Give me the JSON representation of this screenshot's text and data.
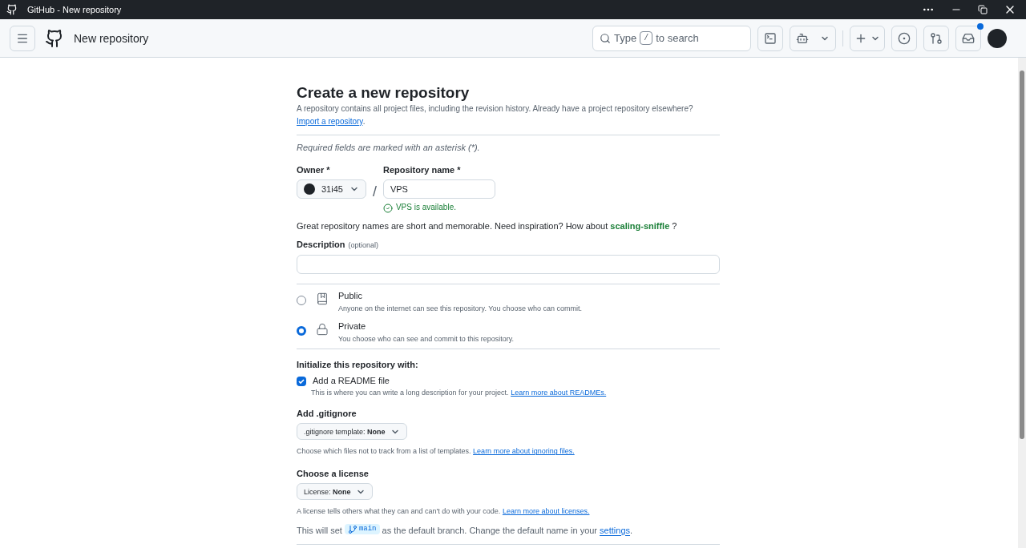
{
  "window": {
    "title": "GitHub - New repository"
  },
  "header": {
    "title": "New repository",
    "search": {
      "before": "Type",
      "key": "/",
      "after": "to search"
    },
    "has_notification": true
  },
  "page": {
    "heading": "Create a new repository",
    "intro": "A repository contains all project files, including the revision history. Already have a project repository elsewhere?",
    "intro_link": "Import a repository",
    "intro_end": ".",
    "required_note": "Required fields are marked with an asterisk (*).",
    "owner": {
      "label": "Owner *",
      "value": "31i45"
    },
    "separator": "/",
    "repo_name": {
      "label": "Repository name *",
      "value": "VPS",
      "status": "VPS is available."
    },
    "suggestion": {
      "before": "Great repository names are short and memorable. Need inspiration? How about",
      "name": "scaling-sniffle",
      "after": "?"
    },
    "description": {
      "label": "Description",
      "hint": "(optional)"
    },
    "visibility": [
      {
        "kind": "public",
        "label": "Public",
        "note": "Anyone on the internet can see this repository. You choose who can commit.",
        "selected": false
      },
      {
        "kind": "private",
        "label": "Private",
        "note": "You choose who can see and commit to this repository.",
        "selected": true
      }
    ],
    "init_heading": "Initialize this repository with:",
    "readme": {
      "label": "Add a README file",
      "checked": true,
      "note": "This is where you can write a long description for your project.",
      "link": "Learn more about READMEs."
    },
    "gitignore": {
      "heading": "Add .gitignore",
      "select": ".gitignore template: **None**",
      "note": "Choose which files not to track from a list of templates.",
      "link": "Learn more about ignoring files."
    },
    "license": {
      "heading": "Choose a license",
      "select": "License: **None**",
      "note": "A license tells others what they can and can't do with your code.",
      "link": "Learn more about licenses."
    },
    "branch": {
      "before": "This will set",
      "branch": "main",
      "middle": "as the default branch. Change the default name in your",
      "link": "settings",
      "end": "."
    }
  }
}
